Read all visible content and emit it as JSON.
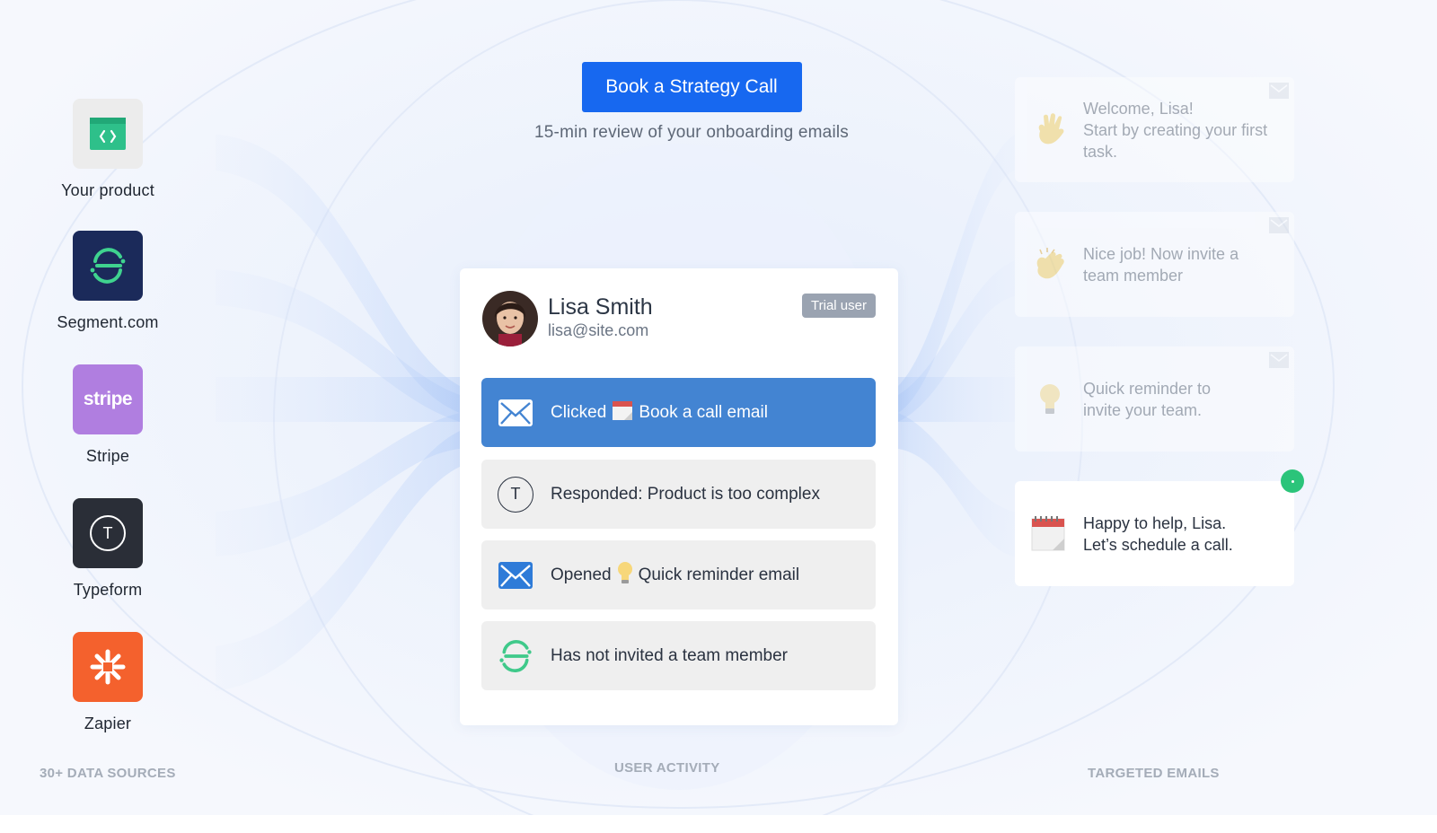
{
  "cta": {
    "button_label": "Book a Strategy Call",
    "subtitle": "15-min review of your onboarding emails"
  },
  "sources": {
    "caption": "30+ DATA SOURCES",
    "items": [
      {
        "label": "Your product",
        "icon": "code-window-icon",
        "color": "#ececec"
      },
      {
        "label": "Segment.com",
        "icon": "segment-logo-icon",
        "color": "#1b2a5a"
      },
      {
        "label": "Stripe",
        "icon": "stripe-logo-icon",
        "logo_text": "stripe",
        "color": "#b07ee0"
      },
      {
        "label": "Typeform",
        "icon": "typeform-logo-icon",
        "logo_text": "T",
        "color": "#2a2e37"
      },
      {
        "label": "Zapier",
        "icon": "zapier-logo-icon",
        "color": "#f4612d"
      }
    ]
  },
  "activity": {
    "caption": "USER ACTIVITY",
    "user": {
      "name": "Lisa Smith",
      "email": "lisa@site.com",
      "badge": "Trial user"
    },
    "items": [
      {
        "prefix": "Clicked",
        "emoji": "calendar-icon",
        "text": "Book a call email",
        "icon": "mail-icon",
        "active": true
      },
      {
        "prefix": "",
        "emoji": "",
        "text": "Responded: Product is too complex",
        "icon": "typeform-icon",
        "icon_text": "T",
        "active": false
      },
      {
        "prefix": "Opened",
        "emoji": "lightbulb-icon",
        "text": "Quick reminder email",
        "icon": "mail-icon",
        "active": false
      },
      {
        "prefix": "",
        "emoji": "",
        "text": "Has not invited a team member",
        "icon": "segment-icon",
        "active": false
      }
    ]
  },
  "emails": {
    "caption": "TARGETED EMAILS",
    "items": [
      {
        "line1": "Welcome, Lisa!",
        "line2": "Start by creating your first task.",
        "icon": "waving-hand-icon",
        "state": "sent"
      },
      {
        "line1": "Nice job! Now invite a",
        "line2": "team member",
        "icon": "clapping-hands-icon",
        "state": "sent"
      },
      {
        "line1": "Quick reminder to",
        "line2": "invite your team.",
        "icon": "lightbulb-icon",
        "state": "sent"
      },
      {
        "line1": "Happy to help, Lisa.",
        "line2": "Let’s schedule a call.",
        "icon": "calendar-icon",
        "state": "active"
      }
    ]
  },
  "colors": {
    "accent": "#1768f0",
    "active_row": "#4384d2",
    "badge": "#9aa3b1",
    "status_dot": "#2bc47a"
  }
}
